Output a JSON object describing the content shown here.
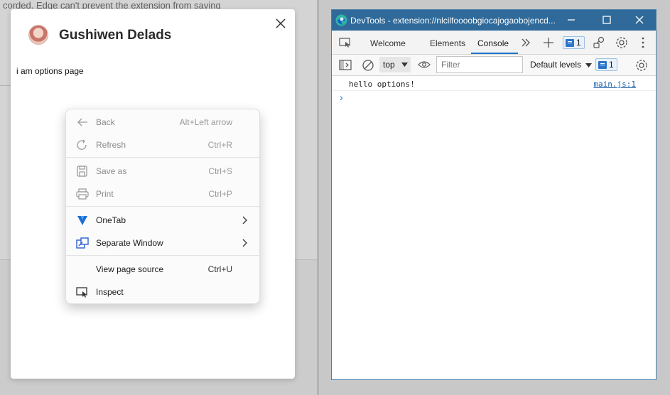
{
  "background": {
    "notice_text": "corded. Edge can't prevent the extension from saving"
  },
  "dialog": {
    "title": "Gushiwen Delads",
    "body_text": "i am options page",
    "close_icon": "close-icon"
  },
  "context_menu": {
    "items": [
      {
        "label": "Back",
        "shortcut": "Alt+Left arrow",
        "icon": "back-arrow-icon",
        "enabled": false
      },
      {
        "label": "Refresh",
        "shortcut": "Ctrl+R",
        "icon": "refresh-icon",
        "enabled": false
      },
      {
        "label": "Save as",
        "shortcut": "Ctrl+S",
        "icon": "save-icon",
        "enabled": false
      },
      {
        "label": "Print",
        "shortcut": "Ctrl+P",
        "icon": "printer-icon",
        "enabled": false
      },
      {
        "label": "OneTab",
        "shortcut": "",
        "icon": "onetab-icon",
        "enabled": true,
        "submenu": true
      },
      {
        "label": "Separate Window",
        "shortcut": "",
        "icon": "separate-window-icon",
        "enabled": true,
        "submenu": true
      },
      {
        "label": "View page source",
        "shortcut": "Ctrl+U",
        "icon": "",
        "enabled": true
      },
      {
        "label": "Inspect",
        "shortcut": "",
        "icon": "inspect-icon",
        "enabled": true
      }
    ]
  },
  "devtools": {
    "title": "DevTools - extension://nlcilfoooobgiocajogaobojencd...",
    "tabs": [
      "Welcome",
      "Elements",
      "Console"
    ],
    "active_tab": "Console",
    "issues_count": "1",
    "toolbar": {
      "context": "top",
      "filter_placeholder": "Filter",
      "levels": "Default levels",
      "messages_count": "1"
    },
    "console": {
      "messages": [
        {
          "text": "hello options!",
          "source": "main.js:1"
        }
      ],
      "prompt": "›"
    },
    "colors": {
      "titlebar": "#2f6a9a",
      "accent": "#1a73c9"
    }
  }
}
